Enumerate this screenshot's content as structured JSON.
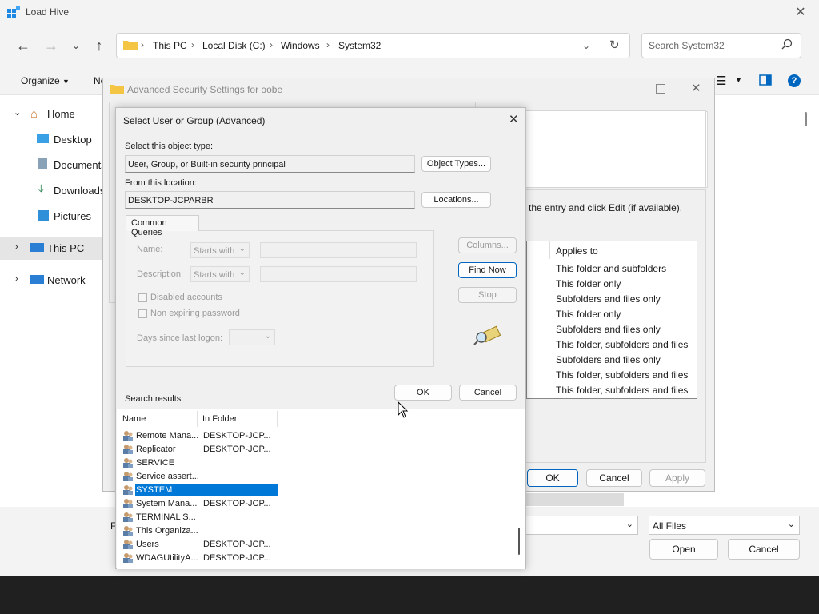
{
  "load_hive": {
    "title": "Load Hive",
    "breadcrumb": [
      "This PC",
      "Local Disk (C:)",
      "Windows",
      "System32"
    ],
    "search_placeholder": "Search System32",
    "organize_label": "Organize",
    "new_folder_label": "Ne",
    "nav_items": [
      {
        "label": "Home",
        "icon": "home-icon"
      },
      {
        "label": "Desktop",
        "icon": "desktop-icon"
      },
      {
        "label": "Documents",
        "icon": "documents-icon"
      },
      {
        "label": "Downloads",
        "icon": "downloads-icon"
      },
      {
        "label": "Pictures",
        "icon": "pictures-icon"
      },
      {
        "label": "This PC",
        "icon": "pc-icon"
      },
      {
        "label": "Network",
        "icon": "network-icon"
      }
    ],
    "file_name_label": "F",
    "filetype_value": "All Files",
    "open_label": "Open",
    "cancel_label": "Cancel"
  },
  "advanced_security": {
    "title": "Advanced Security Settings for oobe",
    "instruction_text": "the entry and click Edit (if available).",
    "applies_to_header": "Applies to",
    "applies_to_rows": [
      "This folder and subfolders",
      "This folder only",
      "Subfolders and files only",
      "This folder only",
      "Subfolders and files only",
      "This folder, subfolders and files",
      "Subfolders and files only",
      "This folder, subfolders and files",
      "This folder, subfolders and files"
    ],
    "ok_label": "OK",
    "cancel_label": "Cancel",
    "apply_label": "Apply"
  },
  "select_dialog": {
    "title": "Select User or Group (Advanced)",
    "object_type_label": "Select this object type:",
    "object_type_value": "User, Group, or Built-in security principal",
    "object_types_button": "Object Types...",
    "location_label": "From this location:",
    "location_value": "DESKTOP-JCPARBR",
    "locations_button": "Locations...",
    "common_queries_tab": "Common Queries",
    "name_label": "Name:",
    "description_label": "Description:",
    "starts_with": "Starts with",
    "disabled_accounts": "Disabled accounts",
    "non_expiring_password": "Non expiring password",
    "days_since_logon": "Days since last logon:",
    "columns_button": "Columns...",
    "find_now_button": "Find Now",
    "stop_button": "Stop",
    "ok_label": "OK",
    "cancel_label": "Cancel",
    "search_results_label": "Search results:",
    "col_name": "Name",
    "col_folder": "In Folder",
    "results": [
      {
        "name": "Remote Mana...",
        "folder": "DESKTOP-JCP..."
      },
      {
        "name": "Replicator",
        "folder": "DESKTOP-JCP..."
      },
      {
        "name": "SERVICE",
        "folder": ""
      },
      {
        "name": "Service assert...",
        "folder": ""
      },
      {
        "name": "SYSTEM",
        "folder": ""
      },
      {
        "name": "System Mana...",
        "folder": "DESKTOP-JCP..."
      },
      {
        "name": "TERMINAL S...",
        "folder": ""
      },
      {
        "name": "This Organiza...",
        "folder": ""
      },
      {
        "name": "Users",
        "folder": "DESKTOP-JCP..."
      },
      {
        "name": "WDAGUtilityA...",
        "folder": "DESKTOP-JCP..."
      }
    ],
    "selected_index": 4
  },
  "colors": {
    "accent": "#0067c0",
    "selection": "#0078d7",
    "dialog_bg": "#f0f0f0",
    "taskbar": "#202020"
  }
}
